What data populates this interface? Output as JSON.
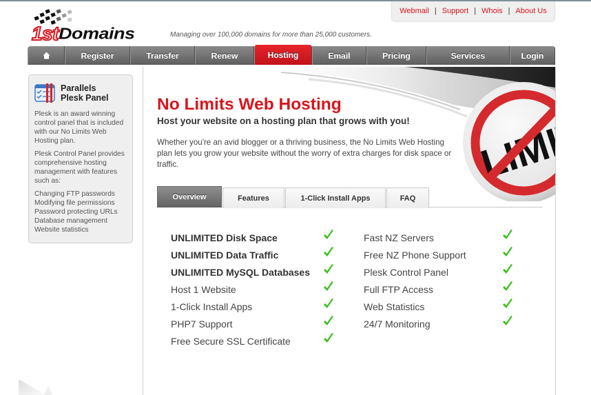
{
  "brand": {
    "logo_first": "1st",
    "logo_rest": "Domains",
    "tagline": "Managing over 100,000 domains for more than 25,000 customers.",
    "accent_color": "#d9151c"
  },
  "utility_links": [
    {
      "label": "Webmail"
    },
    {
      "label": "Support"
    },
    {
      "label": "Whois"
    },
    {
      "label": "About Us"
    }
  ],
  "utility_separator": "|",
  "nav": {
    "home_icon": "home-icon",
    "items": [
      {
        "label": "Register",
        "active": false
      },
      {
        "label": "Transfer",
        "active": false
      },
      {
        "label": "Renew",
        "active": false
      },
      {
        "label": "Hosting",
        "active": true
      },
      {
        "label": "Email",
        "active": false
      },
      {
        "label": "Pricing",
        "active": false
      },
      {
        "label": "Services",
        "active": false
      },
      {
        "label": "Login",
        "active": false
      }
    ]
  },
  "sidebar": {
    "icon": "plesk-panel-icon",
    "title_line1": "Parallels",
    "title_line2": "Plesk Panel",
    "para1": "Plesk is an award winning control panel that is included with our No Limits Web Hosting plan.",
    "para2": "Plesk Control Panel provides comprehensive hosting management with features such as:",
    "features": [
      "Changing FTP passwords",
      "Modifying file permissions",
      "Password protecting URLs",
      "Database management",
      "Website statistics"
    ]
  },
  "main": {
    "title": "No Limits Web Hosting",
    "subtitle": "Host your website on a hosting plan that grows with you!",
    "intro": "Whether you're an avid blogger or a thriving business, the No Limits Web Hosting plan lets you grow your website without the worry of extra charges for disk space or traffic.",
    "banner_image": "no-limits-badge",
    "banner_text": "LIMITS",
    "tabs": [
      {
        "label": "Overview",
        "active": true
      },
      {
        "label": "Features",
        "active": false
      },
      {
        "label": "1-Click Install Apps",
        "active": false
      },
      {
        "label": "FAQ",
        "active": false
      }
    ],
    "features_left": [
      {
        "label": "UNLIMITED Disk Space",
        "bold": true,
        "included": true
      },
      {
        "label": "UNLIMITED Data Traffic",
        "bold": true,
        "included": true
      },
      {
        "label": "UNLIMITED MySQL Databases",
        "bold": true,
        "included": true
      },
      {
        "label": "Host 1 Website",
        "bold": false,
        "included": true
      },
      {
        "label": "1-Click Install Apps",
        "bold": false,
        "included": true
      },
      {
        "label": "PHP7 Support",
        "bold": false,
        "included": true
      },
      {
        "label": "Free Secure SSL Certificate",
        "bold": false,
        "included": true
      }
    ],
    "features_right": [
      {
        "label": "Fast NZ Servers",
        "bold": false,
        "included": true
      },
      {
        "label": "Free NZ Phone Support",
        "bold": false,
        "included": true
      },
      {
        "label": "Plesk Control Panel",
        "bold": false,
        "included": true
      },
      {
        "label": "Full FTP Access",
        "bold": false,
        "included": true
      },
      {
        "label": "Web Statistics",
        "bold": false,
        "included": true
      },
      {
        "label": "24/7 Monitoring",
        "bold": false,
        "included": true
      }
    ],
    "check_color": "#3cbf1e"
  }
}
